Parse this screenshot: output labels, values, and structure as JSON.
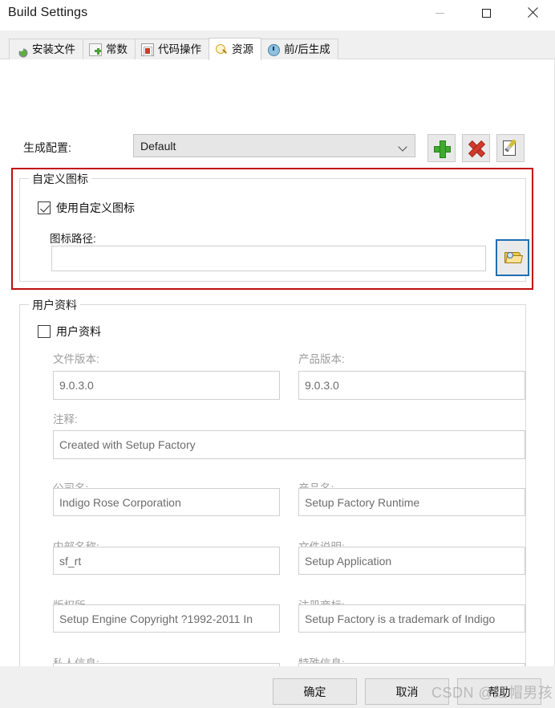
{
  "window": {
    "title": "Build Settings",
    "controls": {
      "minimize": "minimize",
      "maximize": "maximize",
      "close": "close"
    }
  },
  "tabs": [
    {
      "label": "安装文件",
      "icon": "gear-pencil-icon",
      "active": false
    },
    {
      "label": "常数",
      "icon": "document-plus-icon",
      "active": false
    },
    {
      "label": "代码操作",
      "icon": "script-document-icon",
      "active": false
    },
    {
      "label": "资源",
      "icon": "magnifier-icon",
      "active": true
    },
    {
      "label": "前/后生成",
      "icon": "clock-globe-icon",
      "active": false
    }
  ],
  "config_row": {
    "label": "生成配置:",
    "combo_value": "Default",
    "buttons": [
      {
        "name": "add-config-button",
        "icon": "green-plus-icon"
      },
      {
        "name": "delete-config-button",
        "icon": "red-x-icon"
      },
      {
        "name": "edit-config-button",
        "icon": "edit-pencil-icon"
      }
    ]
  },
  "custom_icon_group": {
    "title": "自定义图标",
    "checkbox": {
      "label": "使用自定义图标",
      "checked": true
    },
    "path_label": "图标路径:",
    "path_value": "",
    "browse_button_icon": "folder-browse-icon",
    "highlight_color": "#c00d0d",
    "focus_color": "#1f6fb2"
  },
  "user_data_group": {
    "title": "用户资料",
    "checkbox": {
      "label": "用户资料",
      "checked": false
    },
    "fields": [
      {
        "label": "文件版本:",
        "value": "9.0.3.0"
      },
      {
        "label": "产品版本:",
        "value": "9.0.3.0"
      },
      {
        "label": "注释:",
        "value": "Created with Setup Factory"
      },
      {
        "label": "公司名:",
        "value": "Indigo Rose Corporation"
      },
      {
        "label": "产品名:",
        "value": "Setup Factory Runtime"
      },
      {
        "label": "内部名称:",
        "value": "sf_rt"
      },
      {
        "label": "文件说明:",
        "value": "Setup Application"
      },
      {
        "label": "版权所",
        "value": "Setup Engine Copyright ?1992-2011 In"
      },
      {
        "label": "注册商标:",
        "value": "Setup Factory is a trademark of Indigo"
      },
      {
        "label": "私人信息:",
        "value": ""
      },
      {
        "label": "特殊信息:",
        "value": ""
      }
    ]
  },
  "footer": {
    "ok": "确定",
    "cancel": "取消",
    "help": "帮助"
  },
  "watermark": "CSDN @红帽男孩"
}
